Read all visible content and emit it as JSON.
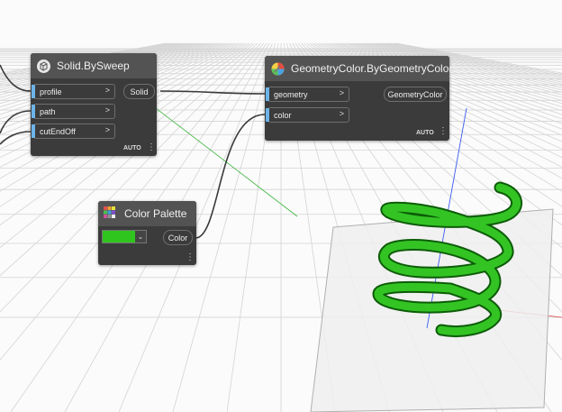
{
  "nodes": {
    "sweep": {
      "title": "Solid.BySweep",
      "inputs": [
        "profile",
        "path",
        "cutEndOff"
      ],
      "output": "Solid",
      "lacing": "AUTO",
      "icon": "solid-sweep-icon"
    },
    "geometry_color": {
      "title": "GeometryColor.ByGeometryColor",
      "inputs": [
        "geometry",
        "color"
      ],
      "output": "GeometryColor",
      "lacing": "AUTO",
      "icon": "color-wheel-icon"
    },
    "palette": {
      "title": "Color Palette",
      "output": "Color",
      "swatch_color": "#2fc51e",
      "icon": "palette-grid-icon"
    }
  },
  "colors": {
    "canvas": "#fbfbfb",
    "grid": "#d4d4d4",
    "node_body": "#3b3b3b",
    "node_header": "#535353",
    "port_marker": "#6cb4ea",
    "wire": "#3a3a3a",
    "helix": "#22a31a",
    "axis_x": "#e04040",
    "axis_y": "#3cb43c",
    "axis_z": "#3a5cf0"
  }
}
